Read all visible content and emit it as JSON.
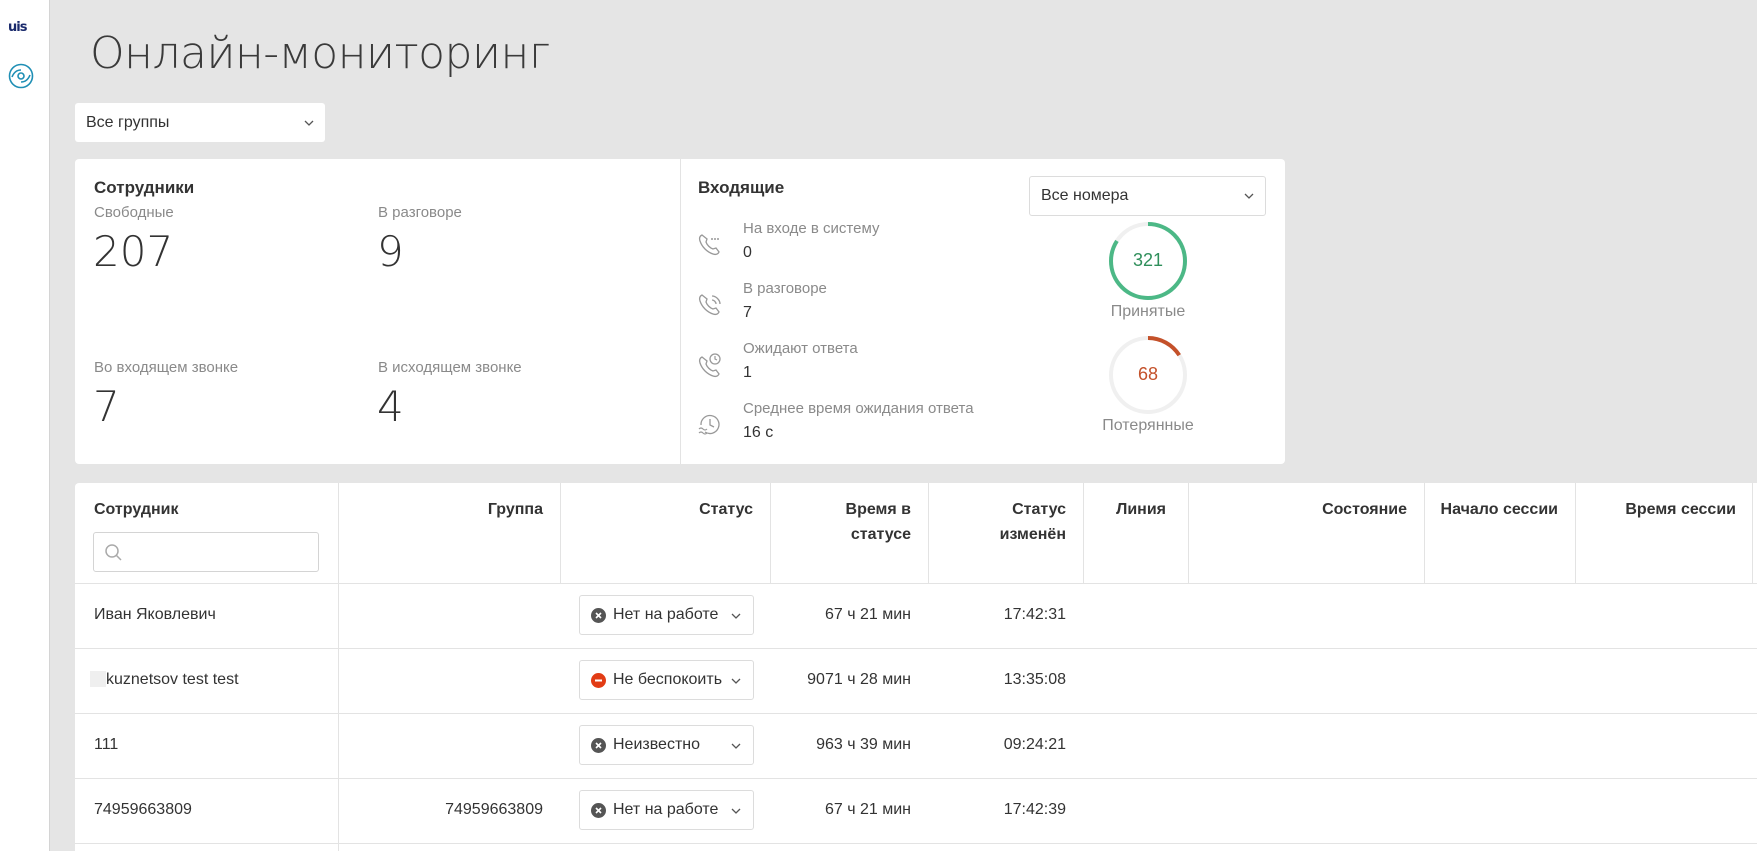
{
  "app": {
    "logo_text": "uis"
  },
  "page": {
    "title": "Онлайн-мониторинг"
  },
  "filters": {
    "group_select": "Все группы",
    "numbers_select": "Все номера"
  },
  "employees": {
    "title": "Сотрудники",
    "free": {
      "label": "Свободные",
      "value": "207"
    },
    "talking": {
      "label": "В разговоре",
      "value": "9"
    },
    "incoming": {
      "label": "Во входящем звонке",
      "value": "7"
    },
    "outgoing": {
      "label": "В исходящем звонке",
      "value": "4"
    }
  },
  "incoming": {
    "title": "Входящие",
    "items": [
      {
        "label": "На входе в систему",
        "value": "0",
        "icon": "phone-dots-icon"
      },
      {
        "label": "В разговоре",
        "value": "7",
        "icon": "phone-talking-icon"
      },
      {
        "label": "Ожидают ответа",
        "value": "1",
        "icon": "phone-clock-icon"
      },
      {
        "label": "Среднее время ожидания ответа",
        "value": "16 с",
        "icon": "history-clock-icon"
      }
    ],
    "accepted": {
      "value": "321",
      "label": "Принятые",
      "color": "#4cb886",
      "fraction": 0.84
    },
    "lost": {
      "value": "68",
      "label": "Потерянные",
      "color": "#c4512a",
      "fraction": 0.16
    }
  },
  "table": {
    "columns": {
      "employee": "Сотрудник",
      "group": "Группа",
      "status": "Статус",
      "time_in_status_1": "Время в",
      "time_in_status_2": "статусе",
      "status_changed_1": "Статус",
      "status_changed_2": "изменён",
      "line": "Линия",
      "state": "Состояние",
      "session_start": "Начало сессии",
      "session_time": "Время сессии"
    },
    "search": {
      "placeholder": ""
    },
    "rows": [
      {
        "employee": "Иван Яковлевич",
        "group": "",
        "status": "Нет на работе",
        "status_color": "#555555",
        "time": "67 ч 21 мин",
        "changed": "17:42:31"
      },
      {
        "employee": "kuznetsov test test",
        "group": "",
        "status": "Не беспокоить",
        "status_color": "#e23c15",
        "time": "9071 ч 28 мин",
        "changed": "13:35:08"
      },
      {
        "employee": "111",
        "group": "",
        "status": "Неизвестно",
        "status_color": "#555555",
        "time": "963 ч 39 мин",
        "changed": "09:24:21"
      },
      {
        "employee": "74959663809",
        "group": "74959663809",
        "status": "Нет на работе",
        "status_color": "#555555",
        "time": "67 ч 21 мин",
        "changed": "17:42:39"
      }
    ]
  }
}
